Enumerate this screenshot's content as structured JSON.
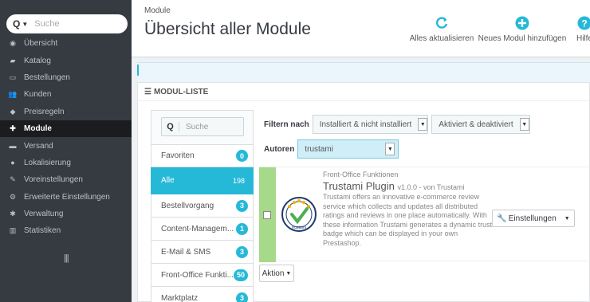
{
  "sidebar": {
    "search_placeholder": "Suche",
    "items": [
      {
        "label": "Übersicht",
        "icon": "dashboard-icon",
        "glyph": "◉"
      },
      {
        "label": "Katalog",
        "icon": "book-icon",
        "glyph": "▰"
      },
      {
        "label": "Bestellungen",
        "icon": "credit-card-icon",
        "glyph": "▭"
      },
      {
        "label": "Kunden",
        "icon": "users-icon",
        "glyph": "👥"
      },
      {
        "label": "Preisregeln",
        "icon": "tag-icon",
        "glyph": "◆"
      },
      {
        "label": "Module",
        "icon": "puzzle-icon",
        "glyph": "✚"
      },
      {
        "label": "Versand",
        "icon": "truck-icon",
        "glyph": "▬"
      },
      {
        "label": "Lokalisierung",
        "icon": "globe-icon",
        "glyph": "●"
      },
      {
        "label": "Voreinstellungen",
        "icon": "wrench-icon",
        "glyph": "✎"
      },
      {
        "label": "Erweiterte Einstellungen",
        "icon": "cogs-icon",
        "glyph": "⚙"
      },
      {
        "label": "Verwaltung",
        "icon": "cog-icon",
        "glyph": "✱"
      },
      {
        "label": "Statistiken",
        "icon": "bar-chart-icon",
        "glyph": "▥"
      }
    ],
    "active_index": 5
  },
  "header": {
    "breadcrumb": "Module",
    "title": "Übersicht aller Module",
    "toolbar": {
      "refresh_label": "Alles aktualisieren",
      "add_label": "Neues Modul hinzufügen",
      "help_label": "Hilfe"
    }
  },
  "panel": {
    "title": "MODUL-LISTE",
    "category_search_placeholder": "Suche",
    "categories": [
      {
        "label": "Favoriten",
        "count": "0"
      },
      {
        "label": "Alle",
        "count": "198"
      },
      {
        "label": "Bestellvorgang",
        "count": "3"
      },
      {
        "label": "Content-Managem...",
        "count": "1"
      },
      {
        "label": "E-Mail & SMS",
        "count": "3"
      },
      {
        "label": "Front-Office Funkti...",
        "count": "50"
      },
      {
        "label": "Marktplatz",
        "count": "3"
      }
    ],
    "active_category_index": 1,
    "filter_label": "Filtern nach",
    "filter_install": "Installiert & nicht installiert",
    "filter_active": "Aktiviert & deaktiviert",
    "author_label": "Autoren",
    "author_value": "trustami"
  },
  "module": {
    "category": "Front-Office Funktionen",
    "name": "Trustami Plugin",
    "version": "v1.0.0 - von Trustami",
    "description": "Trustami offers an innovative e-commerce review service which collects and updates all distributed ratings and reviews in one place automatically. With these information Trustami generates a dynamic trust badge which can be displayed in your own Prestashop.",
    "config_button": "Einstellungen",
    "status_color": "#a7d98b"
  },
  "bulk_action_label": "Aktion",
  "colors": {
    "accent": "#25b9d7",
    "sidebar": "#363a41",
    "success": "#72c279"
  }
}
